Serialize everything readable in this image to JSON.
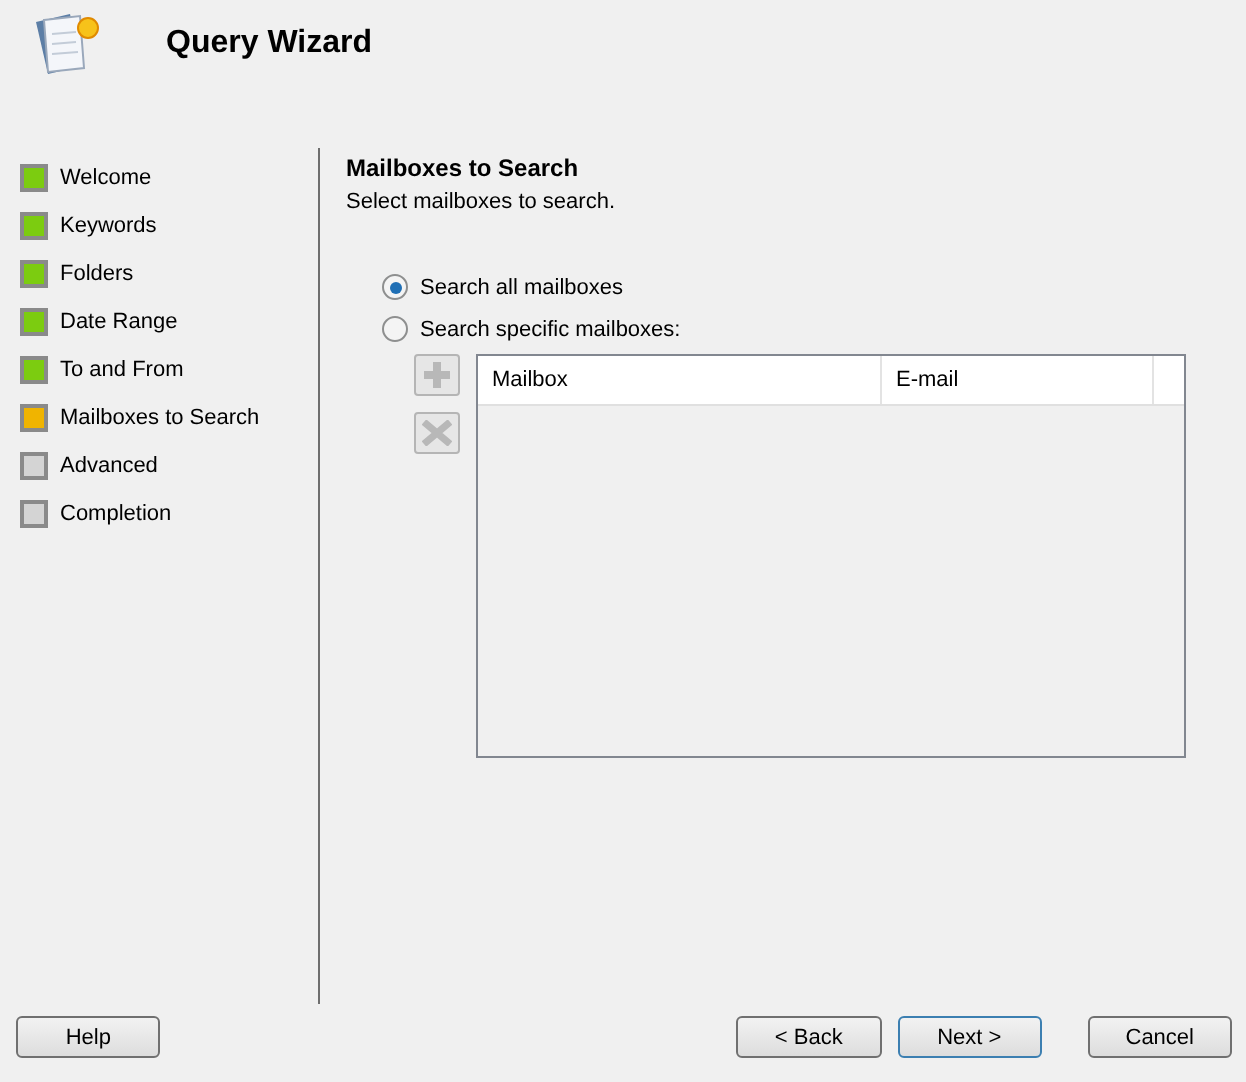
{
  "window": {
    "title": "Query Wizard"
  },
  "steps": [
    {
      "label": "Welcome",
      "color": "#7ccc10"
    },
    {
      "label": "Keywords",
      "color": "#7ccc10"
    },
    {
      "label": "Folders",
      "color": "#7ccc10"
    },
    {
      "label": "Date Range",
      "color": "#7ccc10"
    },
    {
      "label": "To and From",
      "color": "#7ccc10"
    },
    {
      "label": "Mailboxes to Search",
      "color": "#f0b400"
    },
    {
      "label": "Advanced",
      "color": "#d4d4d4"
    },
    {
      "label": "Completion",
      "color": "#d4d4d4"
    }
  ],
  "page": {
    "heading": "Mailboxes to Search",
    "description": "Select mailboxes to search."
  },
  "options": [
    {
      "label": "Search all mailboxes",
      "selected": true
    },
    {
      "label": "Search specific mailboxes:",
      "selected": false
    }
  ],
  "mailbox_list": {
    "disabled": true,
    "columns": [
      "Mailbox",
      "E-mail"
    ]
  },
  "buttons": [
    {
      "label": "Help",
      "default": false
    },
    {
      "label": "< Back",
      "default": false
    },
    {
      "label": "Next >",
      "default": true
    },
    {
      "label": "Cancel",
      "default": false
    }
  ]
}
